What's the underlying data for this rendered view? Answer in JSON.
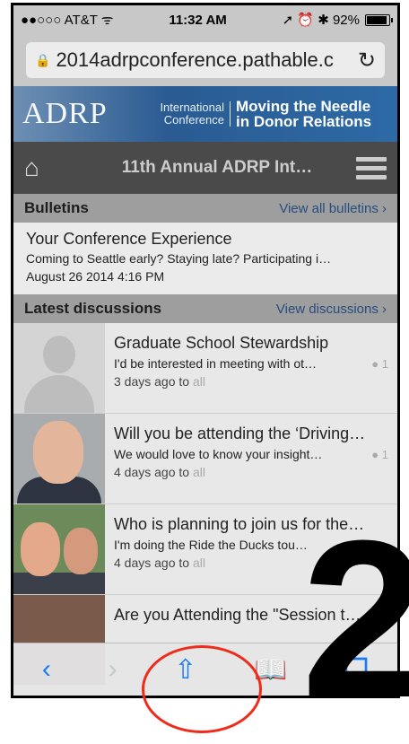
{
  "status": {
    "carrier": "●●○○○ AT&T ᯤ",
    "time": "11:32 AM",
    "right": "➚ ⏰ ✱ 92%"
  },
  "url": {
    "lock": "🔒",
    "text": "2014adrpconference.pathable.c",
    "reload": "↻"
  },
  "banner": {
    "logo": "ADRP",
    "intl": "International Conference",
    "tagline_1": "Moving the Needle",
    "tagline_2": "in Donor Relations"
  },
  "navbar": {
    "title": "11th Annual ADRP Int…",
    "home_icon": "⌂"
  },
  "bulletins": {
    "header": "Bulletins",
    "link": "View all bulletins  ›",
    "title": "Your Conference Experience",
    "summary": "Coming to Seattle early? Staying late? Participating i…",
    "date": "August 26 2014 4:16 PM"
  },
  "discussions": {
    "header": "Latest discussions",
    "link": "View discussions  ›",
    "items": [
      {
        "title": "Graduate School Stewardship",
        "excerpt": "I'd be interested in meeting with ot…",
        "count": "● 1",
        "when": "3 days ago to ",
        "scope": "all"
      },
      {
        "title": "Will you be attending the ‘Driving…",
        "excerpt": "We would love to know your insight…",
        "count": "● 1",
        "when": "4 days ago to ",
        "scope": "all"
      },
      {
        "title": "Who is planning to join us for the…",
        "excerpt": "I'm doing the Ride the Ducks tou…",
        "count": "",
        "when": "4 days ago to ",
        "scope": "all"
      },
      {
        "title": "Are you Attending the \"Session t…",
        "excerpt": "",
        "count": "",
        "when": "",
        "scope": ""
      }
    ]
  },
  "toolbar": {
    "back": "‹",
    "forward": "›",
    "share": "⇧",
    "bookmarks": "📖",
    "tabs": "❐"
  },
  "annotation": {
    "number": "2"
  },
  "colors": {
    "accent": "#1a7cf5",
    "navbar": "#4a4a4a",
    "annotation": "#ef2b1a"
  }
}
